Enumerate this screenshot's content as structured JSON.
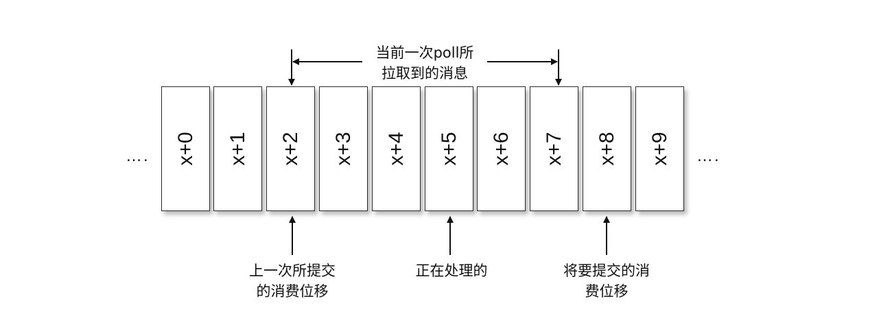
{
  "cells": [
    "x+0",
    "x+1",
    "x+2",
    "x+3",
    "x+4",
    "x+5",
    "x+6",
    "x+7",
    "x+8",
    "x+9"
  ],
  "ellipsis_left": "….",
  "ellipsis_right": "….",
  "top_caption": {
    "line1": "当前一次poll所",
    "line2": "拉取到的消息"
  },
  "bottom_captions": [
    {
      "line1": "上一次所提交",
      "line2": "的消费位移"
    },
    {
      "line1": "正在处理的",
      "line2": ""
    },
    {
      "line1": "将要提交的消",
      "line2": "费位移"
    }
  ]
}
